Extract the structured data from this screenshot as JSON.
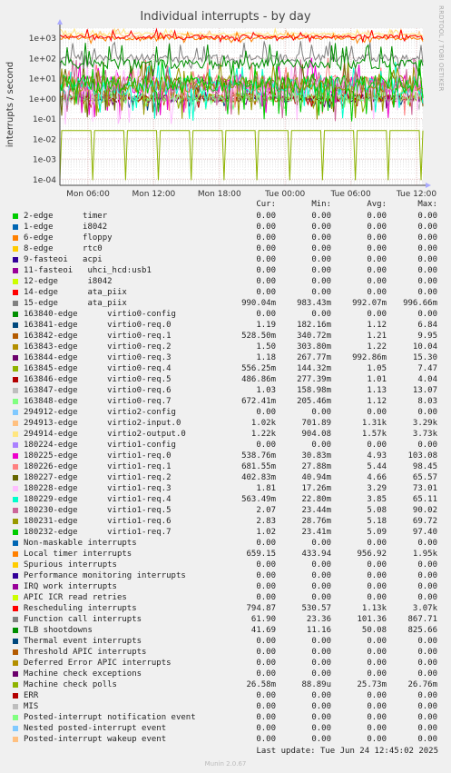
{
  "graph": {
    "title": "Individual interrupts - by day",
    "side_label": "RRDTOOL / TOBI OETIKER",
    "footer": "Last update: Tue Jun 24 12:45:02 2025",
    "munin": "Munin 2.0.67"
  },
  "chart_data": {
    "type": "line",
    "title": "Individual interrupts - by day",
    "ylabel": "interrupts / second",
    "yscale": "log",
    "ylim": [
      5e-05,
      3000
    ],
    "y_ticks": [
      "1e-04",
      "1e-03",
      "1e-02",
      "1e-01",
      "1e+00",
      "1e+01",
      "1e+02",
      "1e+03"
    ],
    "x_ticks": [
      "Mon 06:00",
      "Mon 12:00",
      "Mon 18:00",
      "Tue 00:00",
      "Tue 06:00",
      "Tue 12:00"
    ],
    "grid": true,
    "columns": [
      "Cur:",
      "Min:",
      "Avg:",
      "Max:"
    ],
    "series": [
      {
        "name": "2-edge      timer",
        "color": "#00cc00",
        "cur": "0.00",
        "min": "0.00",
        "avg": "0.00",
        "max": "0.00"
      },
      {
        "name": "1-edge      i8042",
        "color": "#0066b3",
        "cur": "0.00",
        "min": "0.00",
        "avg": "0.00",
        "max": "0.00"
      },
      {
        "name": "6-edge      floppy",
        "color": "#ff8000",
        "cur": "0.00",
        "min": "0.00",
        "avg": "0.00",
        "max": "0.00"
      },
      {
        "name": "8-edge      rtc0",
        "color": "#ffcc00",
        "cur": "0.00",
        "min": "0.00",
        "avg": "0.00",
        "max": "0.00"
      },
      {
        "name": "9-fasteoi   acpi",
        "color": "#330099",
        "cur": "0.00",
        "min": "0.00",
        "avg": "0.00",
        "max": "0.00"
      },
      {
        "name": "11-fasteoi   uhci_hcd:usb1",
        "color": "#990099",
        "cur": "0.00",
        "min": "0.00",
        "avg": "0.00",
        "max": "0.00"
      },
      {
        "name": "12-edge      i8042",
        "color": "#ccff00",
        "cur": "0.00",
        "min": "0.00",
        "avg": "0.00",
        "max": "0.00"
      },
      {
        "name": "14-edge      ata_piix",
        "color": "#ff0000",
        "cur": "0.00",
        "min": "0.00",
        "avg": "0.00",
        "max": "0.00"
      },
      {
        "name": "15-edge      ata_piix",
        "color": "#808080",
        "cur": "990.04m",
        "min": "983.43m",
        "avg": "992.07m",
        "max": "996.66m"
      },
      {
        "name": "163840-edge      virtio0-config",
        "color": "#008f00",
        "cur": "0.00",
        "min": "0.00",
        "avg": "0.00",
        "max": "0.00"
      },
      {
        "name": "163841-edge      virtio0-req.0",
        "color": "#00487d",
        "cur": "1.19",
        "min": "182.16m",
        "avg": "1.12",
        "max": "6.84"
      },
      {
        "name": "163842-edge      virtio0-req.1",
        "color": "#b35a00",
        "cur": "528.50m",
        "min": "340.72m",
        "avg": "1.21",
        "max": "9.95"
      },
      {
        "name": "163843-edge      virtio0-req.2",
        "color": "#b38f00",
        "cur": "1.50",
        "min": "303.80m",
        "avg": "1.22",
        "max": "10.04"
      },
      {
        "name": "163844-edge      virtio0-req.3",
        "color": "#6b006b",
        "cur": "1.18",
        "min": "267.77m",
        "avg": "992.86m",
        "max": "15.30"
      },
      {
        "name": "163845-edge      virtio0-req.4",
        "color": "#8fb300",
        "cur": "556.25m",
        "min": "144.32m",
        "avg": "1.05",
        "max": "7.47"
      },
      {
        "name": "163846-edge      virtio0-req.5",
        "color": "#b30000",
        "cur": "486.86m",
        "min": "277.39m",
        "avg": "1.01",
        "max": "4.04"
      },
      {
        "name": "163847-edge      virtio0-req.6",
        "color": "#bebebe",
        "cur": "1.03",
        "min": "158.98m",
        "avg": "1.13",
        "max": "13.07"
      },
      {
        "name": "163848-edge      virtio0-req.7",
        "color": "#80ff80",
        "cur": "672.41m",
        "min": "205.46m",
        "avg": "1.12",
        "max": "8.03"
      },
      {
        "name": "294912-edge      virtio2-config",
        "color": "#80c9ff",
        "cur": "0.00",
        "min": "0.00",
        "avg": "0.00",
        "max": "0.00"
      },
      {
        "name": "294913-edge      virtio2-input.0",
        "color": "#ffc080",
        "cur": "1.02k",
        "min": "701.89",
        "avg": "1.31k",
        "max": "3.29k"
      },
      {
        "name": "294914-edge      virtio2-output.0",
        "color": "#ffe680",
        "cur": "1.22k",
        "min": "904.08",
        "avg": "1.57k",
        "max": "3.73k"
      },
      {
        "name": "180224-edge      virtio1-config",
        "color": "#aa80ff",
        "cur": "0.00",
        "min": "0.00",
        "avg": "0.00",
        "max": "0.00"
      },
      {
        "name": "180225-edge      virtio1-req.0",
        "color": "#ee00cc",
        "cur": "538.76m",
        "min": "30.83m",
        "avg": "4.93",
        "max": "103.08"
      },
      {
        "name": "180226-edge      virtio1-req.1",
        "color": "#ff8080",
        "cur": "681.55m",
        "min": "27.88m",
        "avg": "5.44",
        "max": "98.45"
      },
      {
        "name": "180227-edge      virtio1-req.2",
        "color": "#666600",
        "cur": "402.83m",
        "min": "40.94m",
        "avg": "4.66",
        "max": "65.57"
      },
      {
        "name": "180228-edge      virtio1-req.3",
        "color": "#ffbfff",
        "cur": "1.81",
        "min": "17.26m",
        "avg": "3.29",
        "max": "73.01"
      },
      {
        "name": "180229-edge      virtio1-req.4",
        "color": "#00ffcc",
        "cur": "563.49m",
        "min": "22.80m",
        "avg": "3.85",
        "max": "65.11"
      },
      {
        "name": "180230-edge      virtio1-req.5",
        "color": "#cc6699",
        "cur": "2.07",
        "min": "23.44m",
        "avg": "5.08",
        "max": "90.02"
      },
      {
        "name": "180231-edge      virtio1-req.6",
        "color": "#999900",
        "cur": "2.83",
        "min": "28.76m",
        "avg": "5.18",
        "max": "69.72"
      },
      {
        "name": "180232-edge      virtio1-req.7",
        "color": "#00cc00",
        "cur": "1.02",
        "min": "23.41m",
        "avg": "5.09",
        "max": "97.40"
      },
      {
        "name": "Non-maskable interrupts",
        "color": "#0066b3",
        "cur": "0.00",
        "min": "0.00",
        "avg": "0.00",
        "max": "0.00"
      },
      {
        "name": "Local timer interrupts",
        "color": "#ff8000",
        "cur": "659.15",
        "min": "433.94",
        "avg": "956.92",
        "max": "1.95k"
      },
      {
        "name": "Spurious interrupts",
        "color": "#ffcc00",
        "cur": "0.00",
        "min": "0.00",
        "avg": "0.00",
        "max": "0.00"
      },
      {
        "name": "Performance monitoring interrupts",
        "color": "#330099",
        "cur": "0.00",
        "min": "0.00",
        "avg": "0.00",
        "max": "0.00"
      },
      {
        "name": "IRQ work interrupts",
        "color": "#990099",
        "cur": "0.00",
        "min": "0.00",
        "avg": "0.00",
        "max": "0.00"
      },
      {
        "name": "APIC ICR read retries",
        "color": "#ccff00",
        "cur": "0.00",
        "min": "0.00",
        "avg": "0.00",
        "max": "0.00"
      },
      {
        "name": "Rescheduling interrupts",
        "color": "#ff0000",
        "cur": "794.87",
        "min": "530.57",
        "avg": "1.13k",
        "max": "3.07k"
      },
      {
        "name": "Function call interrupts",
        "color": "#808080",
        "cur": "61.90",
        "min": "23.36",
        "avg": "101.36",
        "max": "867.71"
      },
      {
        "name": "TLB shootdowns",
        "color": "#008f00",
        "cur": "41.69",
        "min": "11.16",
        "avg": "50.08",
        "max": "825.66"
      },
      {
        "name": "Thermal event interrupts",
        "color": "#00487d",
        "cur": "0.00",
        "min": "0.00",
        "avg": "0.00",
        "max": "0.00"
      },
      {
        "name": "Threshold APIC interrupts",
        "color": "#b35a00",
        "cur": "0.00",
        "min": "0.00",
        "avg": "0.00",
        "max": "0.00"
      },
      {
        "name": "Deferred Error APIC interrupts",
        "color": "#b38f00",
        "cur": "0.00",
        "min": "0.00",
        "avg": "0.00",
        "max": "0.00"
      },
      {
        "name": "Machine check exceptions",
        "color": "#6b006b",
        "cur": "0.00",
        "min": "0.00",
        "avg": "0.00",
        "max": "0.00"
      },
      {
        "name": "Machine check polls",
        "color": "#8fb300",
        "cur": "26.58m",
        "min": "88.89u",
        "avg": "25.73m",
        "max": "26.76m"
      },
      {
        "name": "ERR",
        "color": "#b30000",
        "cur": "0.00",
        "min": "0.00",
        "avg": "0.00",
        "max": "0.00"
      },
      {
        "name": "MIS",
        "color": "#bebebe",
        "cur": "0.00",
        "min": "0.00",
        "avg": "0.00",
        "max": "0.00"
      },
      {
        "name": "Posted-interrupt notification event",
        "color": "#80ff80",
        "cur": "0.00",
        "min": "0.00",
        "avg": "0.00",
        "max": "0.00"
      },
      {
        "name": "Nested posted-interrupt event",
        "color": "#80c9ff",
        "cur": "0.00",
        "min": "0.00",
        "avg": "0.00",
        "max": "0.00"
      },
      {
        "name": "Posted-interrupt wakeup event",
        "color": "#ffc080",
        "cur": "0.00",
        "min": "0.00",
        "avg": "0.00",
        "max": "0.00"
      }
    ]
  }
}
